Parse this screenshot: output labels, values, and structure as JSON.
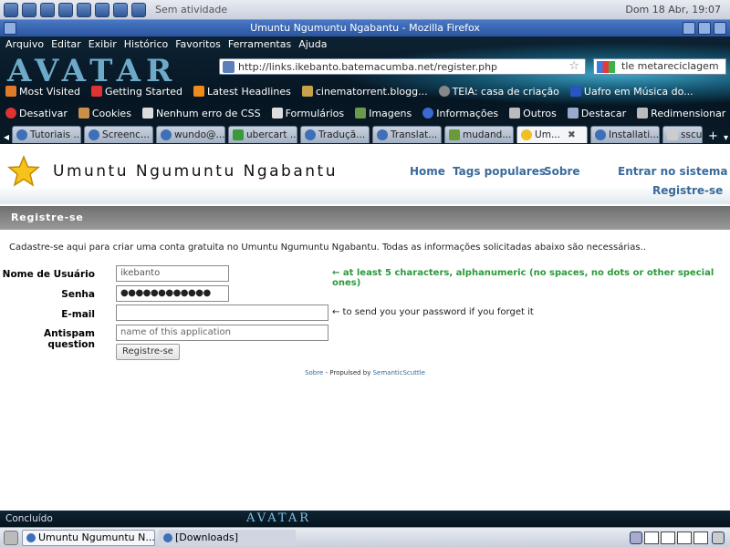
{
  "panel": {
    "activity": "Sem atividade",
    "clock": "Dom 18 Abr, 19:07"
  },
  "window": {
    "title": "Umuntu Ngumuntu Ngabantu - Mozilla Firefox"
  },
  "menu": [
    "Arquivo",
    "Editar",
    "Exibir",
    "Histórico",
    "Favoritos",
    "Ferramentas",
    "Ajuda"
  ],
  "banner_text": "AVATAR",
  "url": "http://links.ikebanto.batemacumba.net/register.php",
  "search": "tle metareciclagem",
  "bookmarks": [
    "Most Visited",
    "Getting Started",
    "Latest Headlines",
    "cinematorrent.blogg...",
    "TEIA: casa de criação",
    "Uafro em Música do..."
  ],
  "devtoolbar": [
    "Desativar",
    "Cookies",
    "Nenhum erro de CSS",
    "Formulários",
    "Imagens",
    "Informações",
    "Outros",
    "Destacar",
    "Redimensionar"
  ],
  "tabs": [
    "Tutoriais ...",
    "Screenc...",
    "wundo@...",
    "ubercart ...",
    "Traduçã...",
    "Translat...",
    "mudand...",
    "Um...",
    "Installati...",
    "sscu"
  ],
  "site": {
    "title": "Umuntu Ngumuntu Ngabantu",
    "nav_home": "Home",
    "nav_tags": "Tags populares",
    "nav_about": "Sobre",
    "nav_login": "Entrar no sistema",
    "nav_register": "Registre-se",
    "section": "Registre-se",
    "intro": "Cadastre-se aqui para criar uma conta gratuita no Umuntu Ngumuntu Ngabantu. Todas as informações solicitadas abaixo são necessárias..",
    "form": {
      "username_label": "Nome de Usuário",
      "username_value": "ikebanto",
      "username_hint": "← at least 5 characters, alphanumeric (no spaces, no dots or other special ones)",
      "password_label": "Senha",
      "password_value": "●●●●●●●●●●●●",
      "email_label": "E-mail",
      "email_value": "",
      "email_hint": "← to send you your password if you forget it",
      "antispam_label": "Antispam question",
      "antispam_placeholder": "name of this application",
      "submit": "Registre-se"
    },
    "footer_about": "Sobre",
    "footer_mid": " - Propulsed by ",
    "footer_link": "SemanticScuttle"
  },
  "status": "Concluído",
  "taskbar": {
    "task1": "Umuntu Ngumuntu N...",
    "task2": "[Downloads]"
  },
  "colors": {
    "hint_green": "#2a9a3a",
    "nav_blue": "#3a6a9a",
    "section_gray": "#7a7a7a"
  }
}
